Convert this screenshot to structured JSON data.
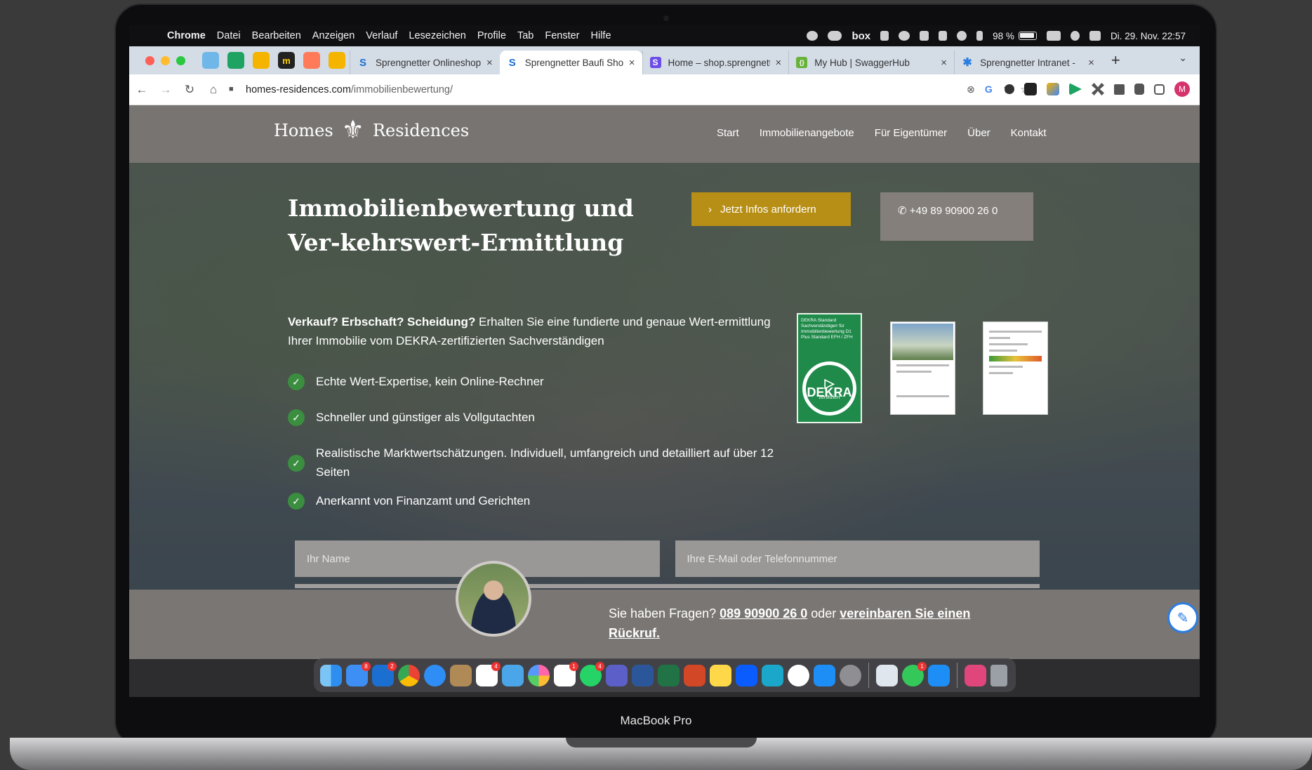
{
  "menubar": {
    "apple": "",
    "items": [
      "Chrome",
      "Datei",
      "Bearbeiten",
      "Anzeigen",
      "Verlauf",
      "Lesezeichen",
      "Profile",
      "Tab",
      "Fenster",
      "Hilfe"
    ],
    "tray_box": "box",
    "battery": "98 %",
    "datetime": "Di. 29. Nov.  22:57"
  },
  "tabs": [
    {
      "title": "Sprengnetter Onlineshop",
      "favicon": "S",
      "fav_color": "#1a6fd1"
    },
    {
      "title": "Sprengnetter Baufi Shop",
      "favicon": "S",
      "fav_color": "#1a6fd1"
    },
    {
      "title": "Home – shop.sprengnetter",
      "favicon": "S",
      "fav_color": "#6b4ee6"
    },
    {
      "title": "My Hub | SwaggerHub",
      "favicon": "{}",
      "fav_color": "#67b33a"
    },
    {
      "title": "Sprengnetter Intranet - ",
      "favicon": "✱",
      "fav_color": "#2a7de1"
    }
  ],
  "toolbar": {
    "url_host": "homes-residences.com",
    "url_path": "/immobilienbewertung/"
  },
  "site": {
    "logo_left": "Homes",
    "logo_right": "Residences",
    "nav": [
      "Start",
      "Immobilienangebote",
      "Für Eigentümer",
      "Über",
      "Kontakt"
    ],
    "headline": "Immobilienbewertung und Ver-kehrswert-Ermittlung",
    "cta_label": "Jetzt Infos anfordern",
    "phone_label": "+49 89 90900 26 0",
    "intro_bold": "Verkauf? Erbschaft? Scheidung?",
    "intro_text": " Erhalten Sie eine fundierte und genaue Wert-ermittlung Ihrer Immobilie vom DEKRA-zertifizierten Sachverständigen",
    "checks": [
      "Echte Wert-Expertise, kein Online-Rechner",
      "Schneller und günstiger als Vollgutachten",
      "Realistische Marktwertschätzungen. Individuell, umfangreich und detailliert auf über 12 Seiten",
      "Anerkannt von Finanzamt und Gerichten"
    ],
    "badge_text": "DEKRA Standard Sachverständige/r für Immobilienbewertung D1 Plus Standard EFH / ZFH",
    "badge_brand": "DEKRA",
    "badge_sub": "zertifiziert",
    "name_placeholder": "Ihr Name",
    "contact_placeholder": "Ihre E-Mail oder Telefonnummer",
    "question_text": "Sie haben Fragen? ",
    "question_phone": "089 90900 26 0",
    "question_or": " oder ",
    "question_link": "vereinbaren Sie einen Rückruf."
  },
  "device_label": "MacBook Pro",
  "colors": {
    "cta": "#b88f16",
    "check": "#3b8e3f",
    "header": "#787471"
  }
}
